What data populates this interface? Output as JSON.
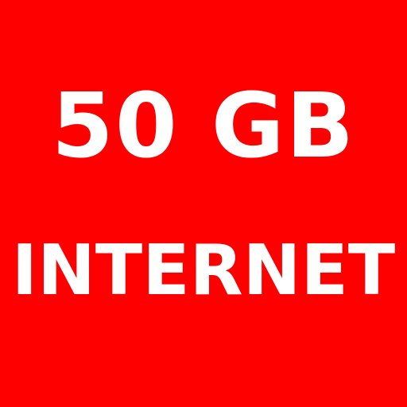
{
  "tile": {
    "background_color": "#ff0000",
    "text_color": "#ffffff",
    "amount": "50 GB",
    "service": "INTERNET"
  }
}
